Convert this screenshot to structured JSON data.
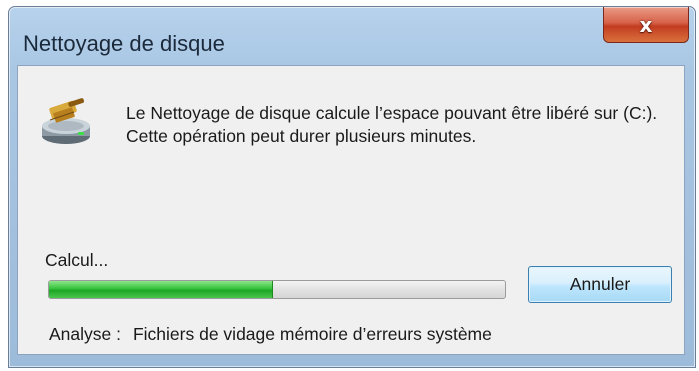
{
  "window": {
    "title": "Nettoyage de disque",
    "close_symbol": "x",
    "close_icon": "close-icon"
  },
  "message": {
    "icon": "disk-cleanup-icon",
    "text": "Le Nettoyage de disque calcule l’espace pouvant être libéré sur  (C:). Cette opération peut durer plusieurs minutes."
  },
  "progress": {
    "label": "Calcul...",
    "fraction": 0.49,
    "fill_color": "#2fbf35"
  },
  "buttons": {
    "cancel_label": "Annuler"
  },
  "analysis": {
    "label": "Analyse :",
    "value": "Fichiers de vidage mémoire d’erreurs système"
  }
}
